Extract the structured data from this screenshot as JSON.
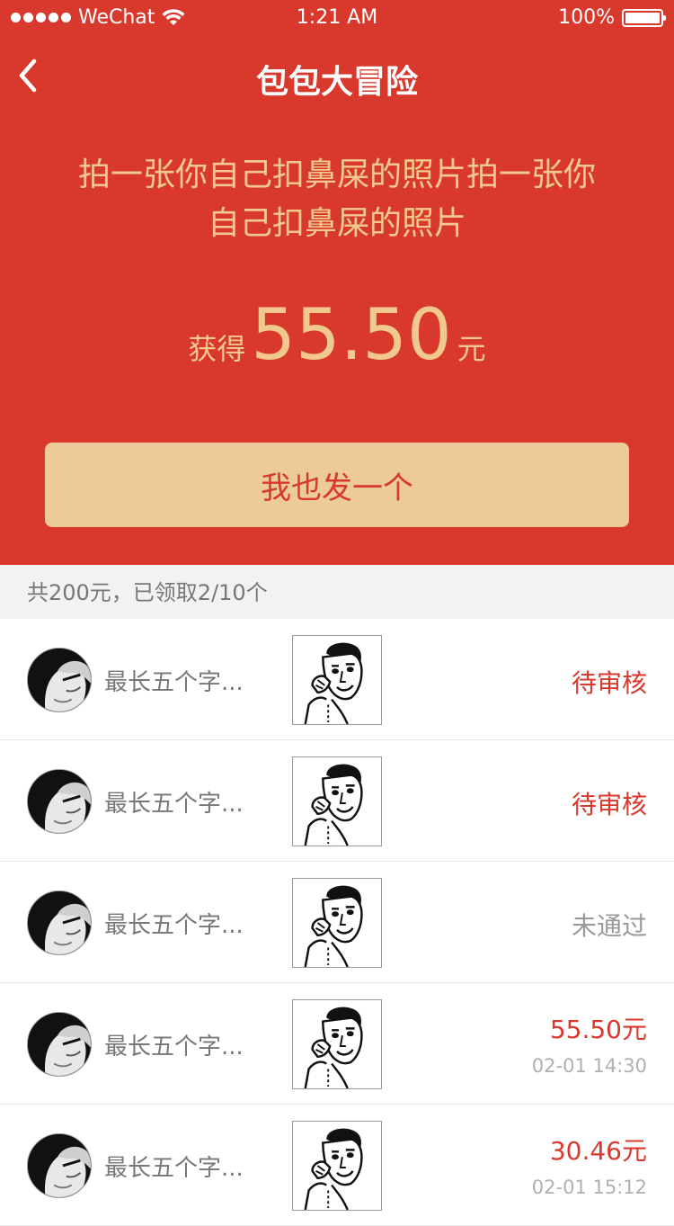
{
  "status_bar": {
    "carrier": "WeChat",
    "time": "1:21 AM",
    "battery": "100%"
  },
  "nav": {
    "title": "包包大冒险"
  },
  "task": {
    "description": "拍一张你自己扣鼻屎的照片拍一张你自己扣鼻屎的照片",
    "amount_prefix": "获得",
    "amount": "55.50",
    "amount_unit": "元",
    "cta": "我也发一个"
  },
  "summary": "共200元，已领取2/10个",
  "entries": [
    {
      "name": "最长五个字...",
      "status": "待审核",
      "status_color": "#d9392d",
      "time": ""
    },
    {
      "name": "最长五个字...",
      "status": "待审核",
      "status_color": "#d9392d",
      "time": ""
    },
    {
      "name": "最长五个字...",
      "status": "未通过",
      "status_color": "#999999",
      "time": ""
    },
    {
      "name": "最长五个字...",
      "status": "55.50元",
      "status_color": "#d9392d",
      "time": "02-01 14:30"
    },
    {
      "name": "最长五个字...",
      "status": "30.46元",
      "status_color": "#d9392d",
      "time": "02-01 15:12"
    }
  ],
  "colors": {
    "primary_red": "#d9392d",
    "gold": "#f1c98e",
    "button_bg": "#ecca99"
  }
}
